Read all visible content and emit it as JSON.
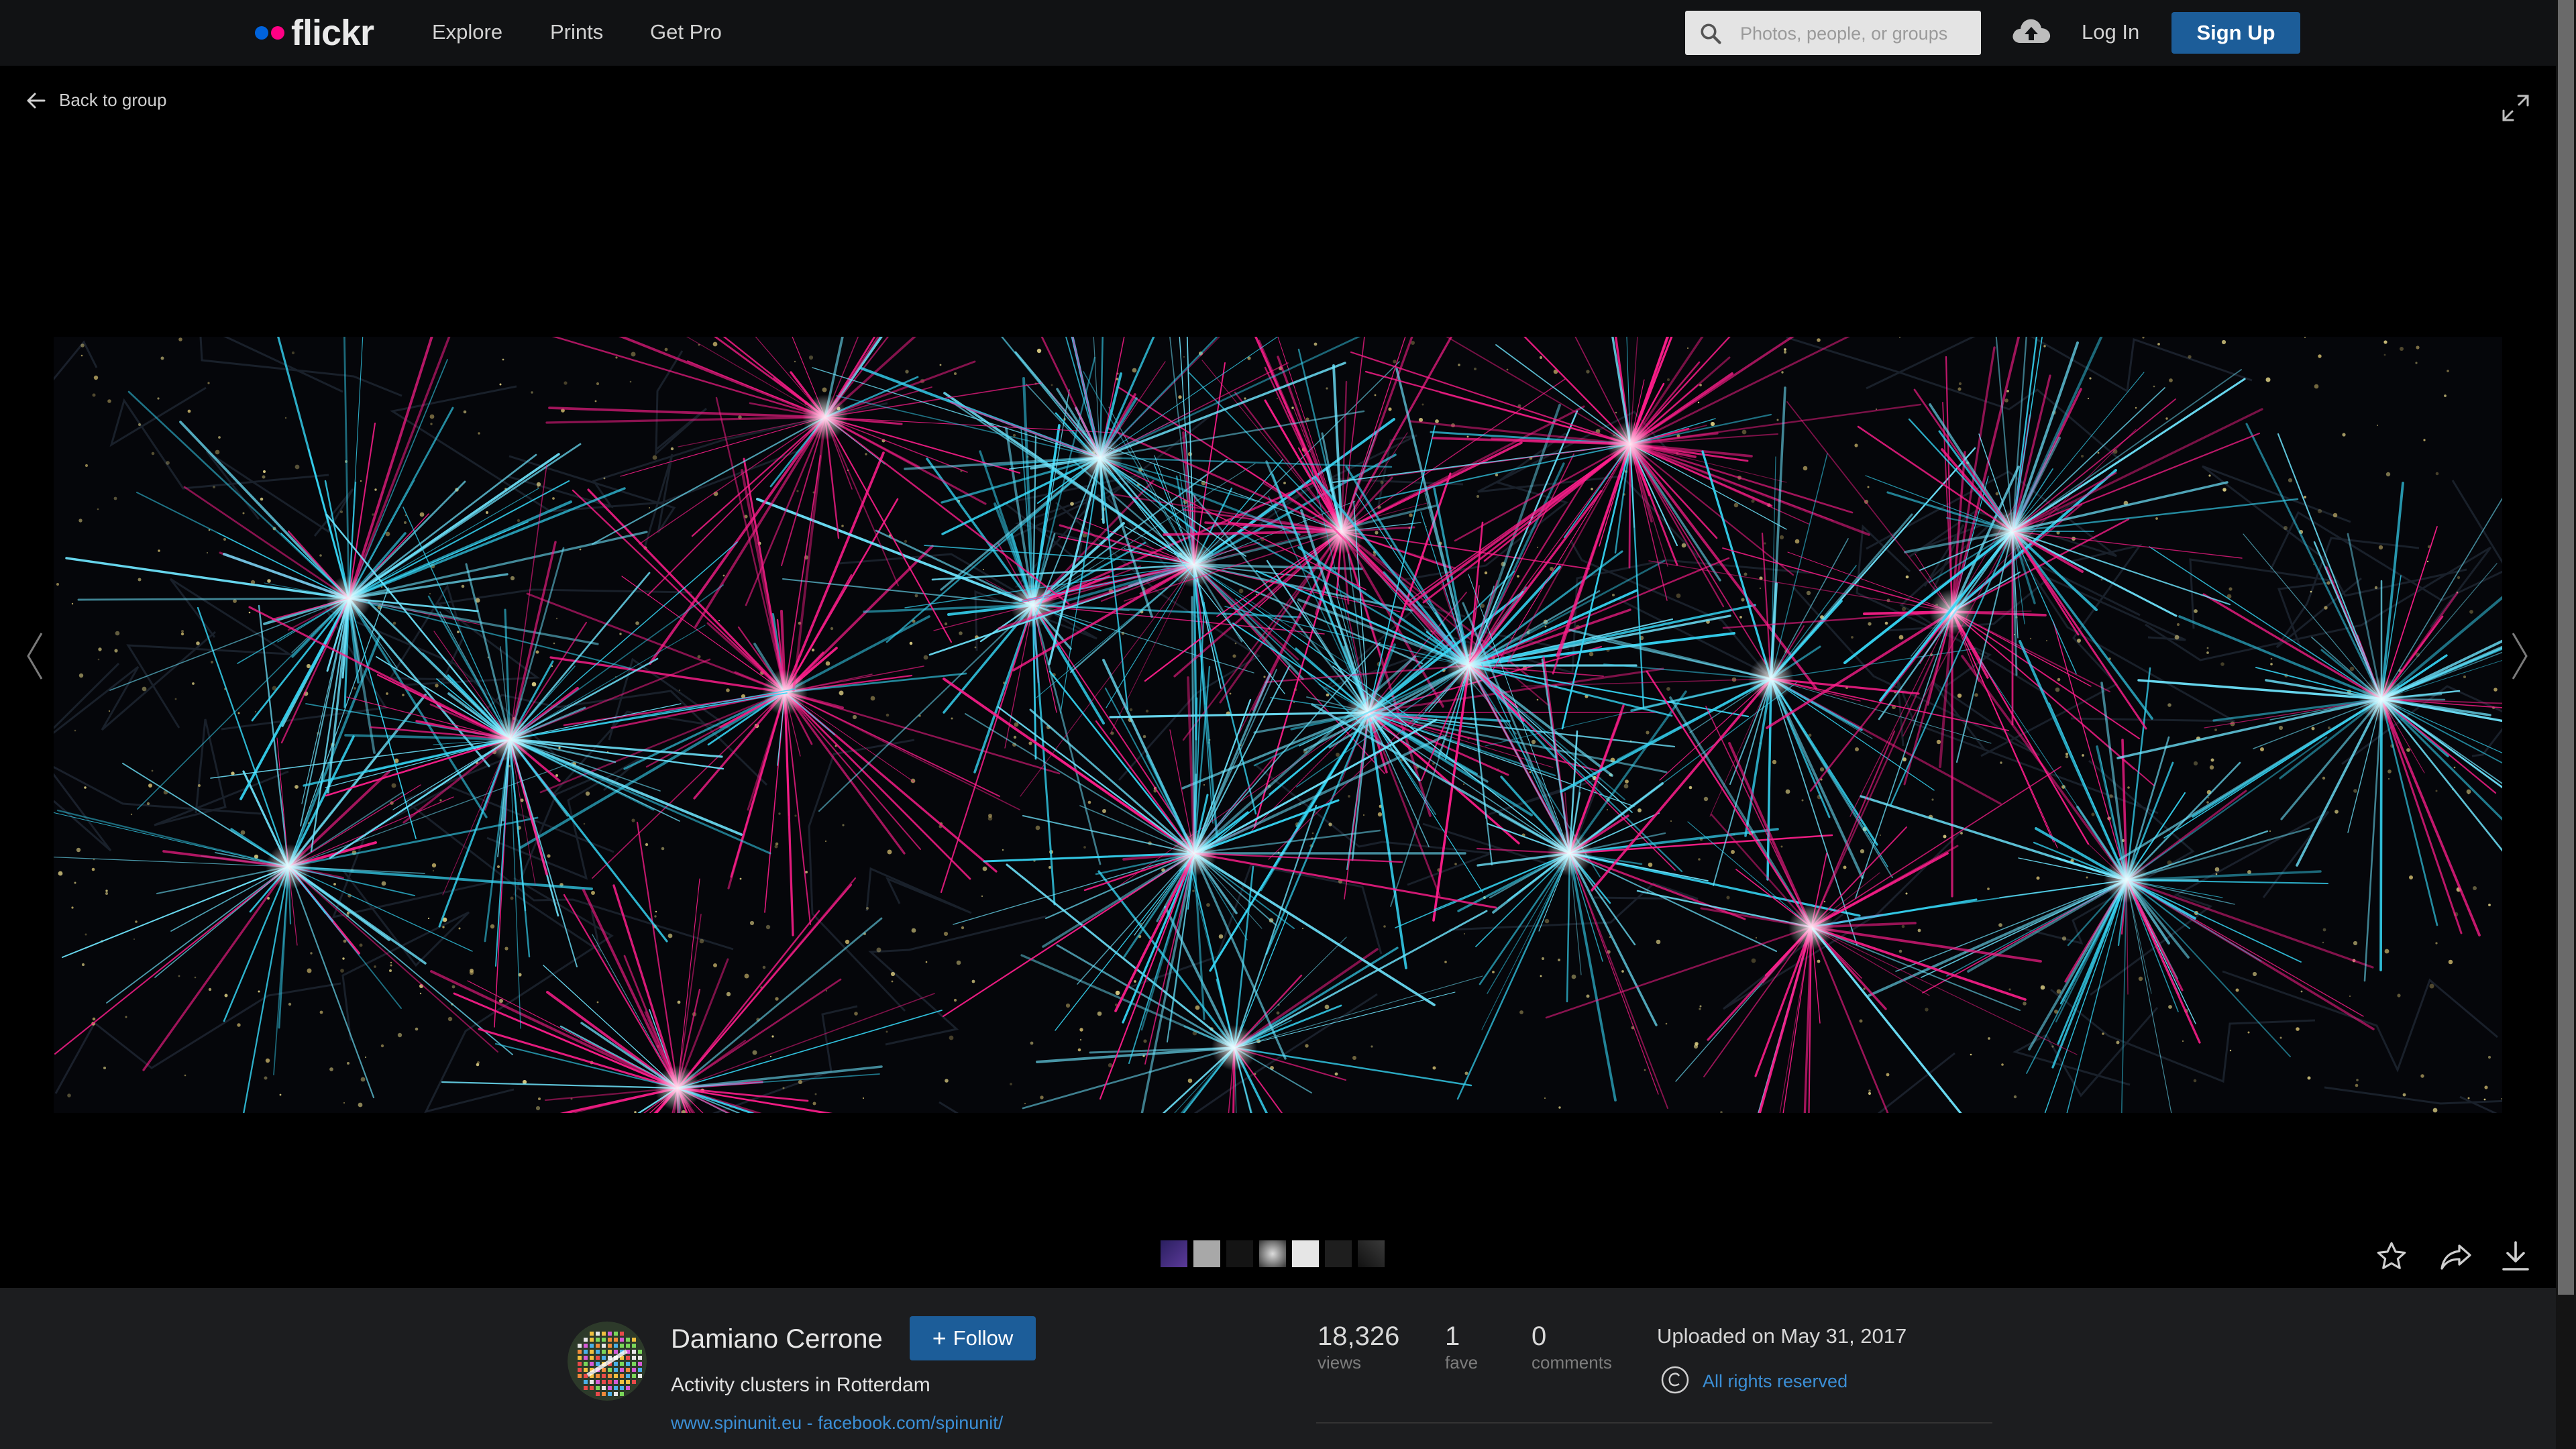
{
  "brand": {
    "name": "flickr",
    "colors": {
      "blue_dot": "#0063dc",
      "pink_dot": "#ff0084",
      "accent": "#1c5d99",
      "link": "#3b8fd6"
    }
  },
  "topbar": {
    "nav": [
      "Explore",
      "Prints",
      "Get Pro"
    ],
    "search_placeholder": "Photos, people, or groups",
    "upload_icon": "cloud-upload-icon",
    "login": "Log In",
    "signup": "Sign Up"
  },
  "back_link": "Back to group",
  "photo": {
    "author": "Damiano Cerrone",
    "follow_label": "Follow",
    "title": "Activity clusters in Rotterdam",
    "links": "www.spinunit.eu - facebook.com/spinunit/"
  },
  "stats": [
    {
      "value": "18,326",
      "label": "views"
    },
    {
      "value": "1",
      "label": "fave"
    },
    {
      "value": "0",
      "label": "comments"
    }
  ],
  "uploaded": "Uploaded on May 31, 2017",
  "license": "All rights reserved",
  "actions": [
    "star-icon",
    "share-icon",
    "download-icon",
    "expand-icon",
    "prev-arrow-icon",
    "next-arrow-icon"
  ]
}
